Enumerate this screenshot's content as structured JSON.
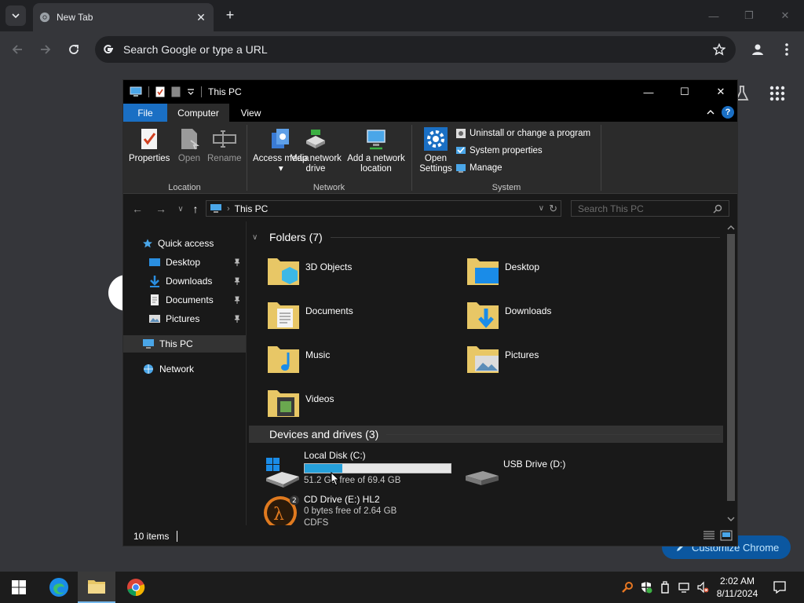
{
  "chrome": {
    "tab_title": "New Tab",
    "omnibox_placeholder": "Search Google or type a URL",
    "customize_label": "Customize Chrome"
  },
  "explorer": {
    "title": "This PC",
    "ribbon_tabs": [
      "File",
      "Computer",
      "View"
    ],
    "ribbon": {
      "location": {
        "label": "Location",
        "properties": "Properties",
        "open": "Open",
        "rename": "Rename"
      },
      "network": {
        "label": "Network",
        "access_media": "Access media",
        "map_drive": "Map network drive",
        "add_location": "Add a network location"
      },
      "system": {
        "label": "System",
        "open_settings": "Open Settings",
        "uninstall": "Uninstall or change a program",
        "system_properties": "System properties",
        "manage": "Manage"
      }
    },
    "address": "This PC",
    "search_placeholder": "Search This PC",
    "nav": {
      "quick_access": "Quick access",
      "desktop": "Desktop",
      "downloads": "Downloads",
      "documents": "Documents",
      "pictures": "Pictures",
      "this_pc": "This PC",
      "network": "Network"
    },
    "folders_header": "Folders (7)",
    "folders": [
      "3D Objects",
      "Desktop",
      "Documents",
      "Downloads",
      "Music",
      "Pictures",
      "Videos"
    ],
    "devices_header": "Devices and drives (3)",
    "drives": {
      "c": {
        "name": "Local Disk (C:)",
        "free": "51.2 GB free of 69.4 GB",
        "used_fraction": 0.26
      },
      "d": {
        "name": "USB Drive (D:)"
      },
      "e": {
        "name": "CD Drive (E:) HL2",
        "free": "0 bytes free of 2.64 GB",
        "fs": "CDFS"
      }
    },
    "status": "10 items"
  },
  "taskbar": {
    "time": "2:02 AM",
    "date": "8/11/2024"
  }
}
